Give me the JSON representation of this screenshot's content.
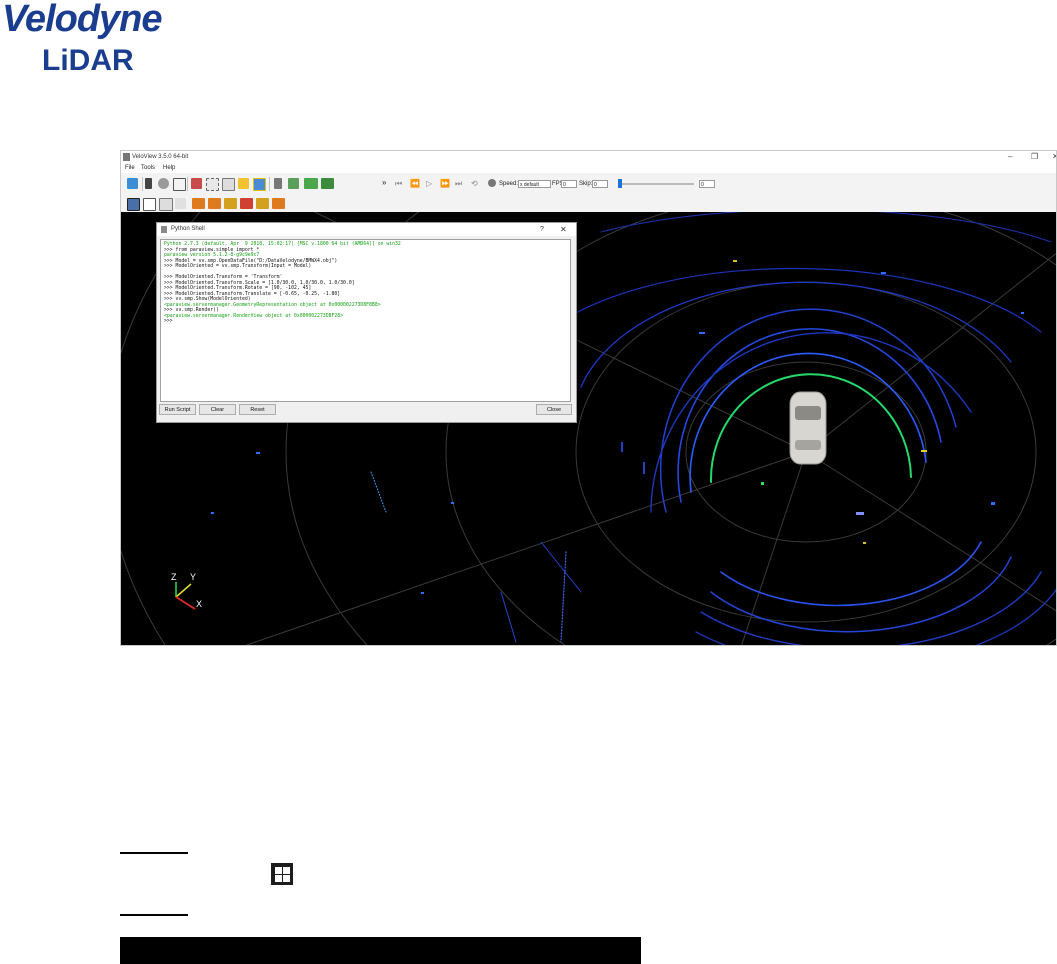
{
  "logo": {
    "line1": "Velodyne",
    "line2": "LiDAR"
  },
  "window": {
    "title": "VeloView 3.5.0 64-bit",
    "minimize": "–",
    "maximize": "❐",
    "close": "✕"
  },
  "menu": [
    "File",
    "Tools",
    "Help"
  ],
  "toolbar": {
    "overflow": "»",
    "speed_label": "Speed:",
    "speed_value": "x default",
    "fps_label": "FPS:",
    "fps_value": "0",
    "skip_label": "Skip:",
    "skip_value": "0",
    "frame_value": "0"
  },
  "python_shell": {
    "title": "Python Shell",
    "help_glyph": "?",
    "close_glyph": "✕",
    "lines": [
      {
        "text": "Python 2.7.3 (default, Apr  9 2018, 15:02:17) [MSC v.1800 64 bit (AMD64)] on win32",
        "kind": "green"
      },
      {
        "text": ">>> from paraview.simple import *",
        "kind": "black"
      },
      {
        "text": "paraview version 5.1.2-8-g9c9e9c7",
        "kind": "green"
      },
      {
        "text": ">>> Model = vv.smp.OpenDataFile(\"D:/DataVelodyne/BMWX4.obj\")",
        "kind": "black"
      },
      {
        "text": ">>> ModelOriented = vv.smp.Transform(Input = Model)",
        "kind": "black"
      },
      {
        "text": "",
        "kind": "black"
      },
      {
        "text": ">>> ModelOriented.Transform = 'Transform'",
        "kind": "black"
      },
      {
        "text": ">>> ModelOriented.Transform.Scale = [1.0/30.0, 1.0/30.0, 1.0/30.0]",
        "kind": "black"
      },
      {
        "text": ">>> ModelOriented.Transform.Rotate = [90, -102, 45]",
        "kind": "black"
      },
      {
        "text": ">>> ModelOriented.Transform.Translate = [-0.65, -0.25, -1.80]",
        "kind": "black"
      },
      {
        "text": ">>> vv.smp.Show(ModelOriented)",
        "kind": "black"
      },
      {
        "text": "<paraview.servermanager.GeometryRepresentation object at 0x000002273D8F8B8>",
        "kind": "green"
      },
      {
        "text": ">>> vv.smp.Render()",
        "kind": "black"
      },
      {
        "text": "<paraview.servermanager.RenderView object at 0x000002273D8F28>",
        "kind": "green"
      },
      {
        "text": ">>>",
        "kind": "black"
      }
    ],
    "buttons": {
      "run": "Run Script",
      "clear": "Clear",
      "reset": "Reset",
      "close": "Close"
    }
  },
  "axes": {
    "z": "Z",
    "y": "Y",
    "x": "X"
  },
  "colors": {
    "brand": "#1a3d8f",
    "viewport_bg": "#000000",
    "console_green": "#14a014"
  }
}
